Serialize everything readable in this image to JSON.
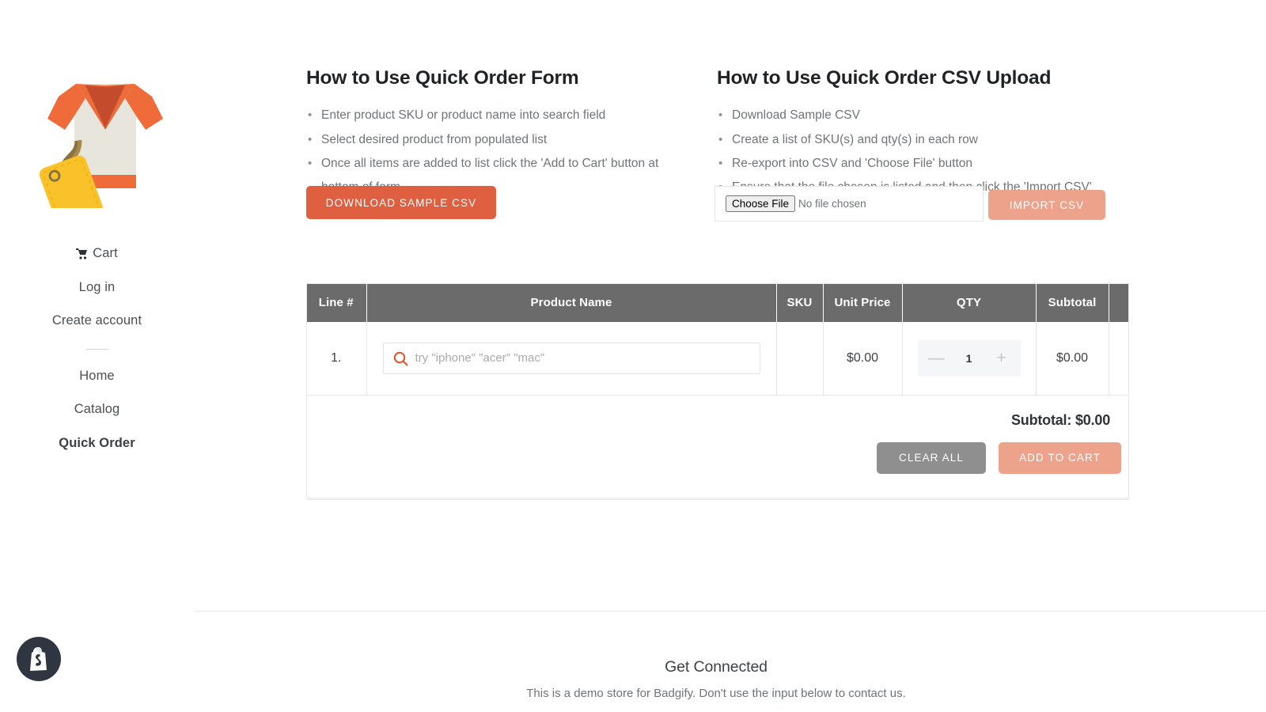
{
  "sidebar": {
    "logo_alt": "tshirt-price-tag-logo",
    "items": [
      {
        "label": "Cart",
        "icon": "shopping-cart-icon",
        "name": "cart",
        "active": false
      },
      {
        "label": "Log in",
        "icon": "",
        "name": "log-in",
        "active": false
      },
      {
        "label": "Create account",
        "icon": "",
        "name": "create-account",
        "active": false
      },
      {
        "label": "Home",
        "icon": "",
        "name": "home",
        "active": false
      },
      {
        "label": "Catalog",
        "icon": "",
        "name": "catalog",
        "active": false
      },
      {
        "label": "Quick Order",
        "icon": "",
        "name": "quick-order",
        "active": true
      }
    ],
    "badge_icon": "shopify-bag-icon"
  },
  "howto_form": {
    "title": "How to Use Quick Order Form",
    "steps": [
      "Enter product SKU or product name into search field",
      "Select desired product from populated list",
      "Once all items are added to list click the 'Add to Cart' button at bottom of form"
    ]
  },
  "howto_csv": {
    "title": "How to Use Quick Order CSV Upload",
    "steps": [
      "Download Sample CSV",
      "Create a list of SKU(s) and qty(s) in each row",
      "Re-export into CSV and 'Choose File' button",
      "Ensure that the file chosen is listed and then click the 'Import CSV' button to add products to cart"
    ]
  },
  "actions": {
    "download_sample_csv": "DOWNLOAD SAMPLE CSV",
    "import_csv": "IMPORT CSV",
    "file_button_label": "Choose file",
    "file_status": "No file chosen"
  },
  "table": {
    "headers": [
      "Line #",
      "Product Name",
      "SKU",
      "Unit Price",
      "QTY",
      "Subtotal",
      ""
    ],
    "rows": [
      {
        "line": "1.",
        "search_placeholder": "try \"iphone\" \"acer\" \"mac\"",
        "search_value": "",
        "sku": "",
        "unit_price": "$0.00",
        "qty": "1",
        "subtotal": "$0.00",
        "minus": "—",
        "plus": "+"
      }
    ],
    "subtotal_label": "Subtotal: $0.00",
    "clear_all": "CLEAR ALL",
    "add_to_cart": "ADD TO CART"
  },
  "footer": {
    "title": "Get Connected",
    "subtitle": "This is a demo store for Badgify. Don't use the input below to contact us."
  },
  "colors": {
    "primary_orange": "#df6040",
    "light_salmon": "#eda28c",
    "table_header_gray": "#6b6b6b",
    "clear_gray": "#8f8f8f",
    "search_icon_orange": "#e8502a",
    "badge_dark": "#2f3642"
  }
}
